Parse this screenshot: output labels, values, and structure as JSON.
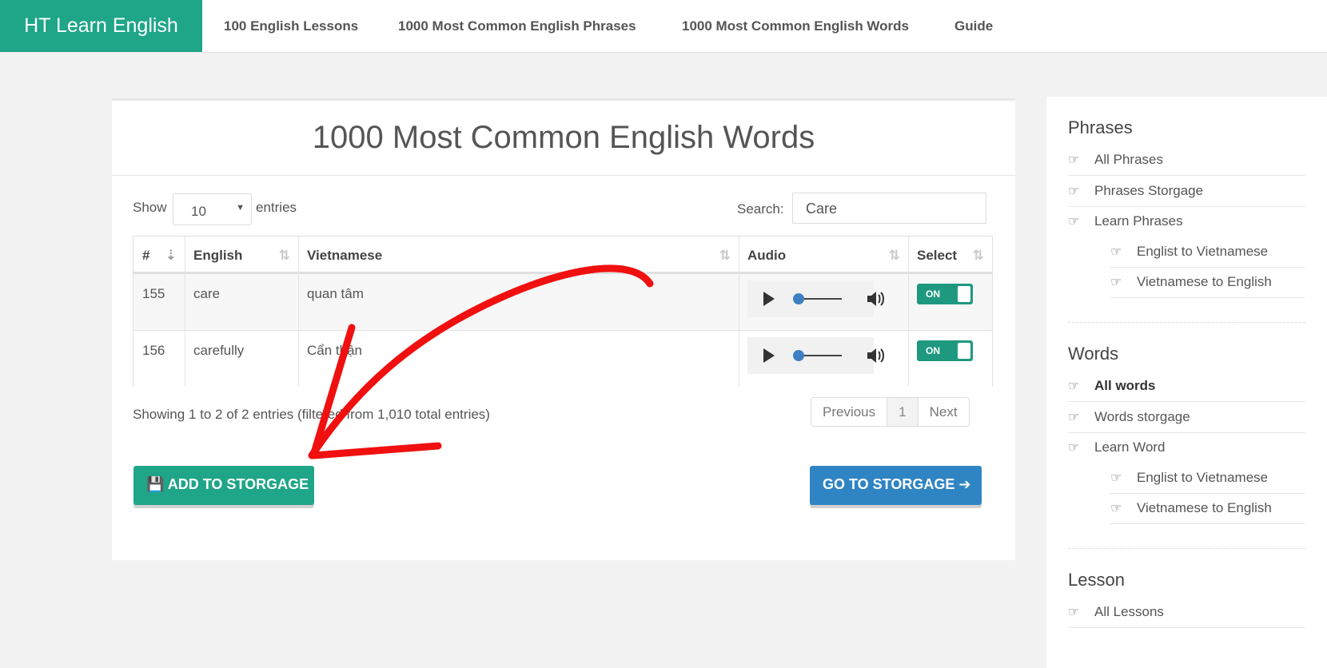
{
  "nav": {
    "brand": "HT Learn English",
    "links": [
      "100 English Lessons",
      "1000 Most Common English Phrases",
      "1000 Most Common English Words",
      "Guide"
    ]
  },
  "main": {
    "title": "1000 Most Common English Words",
    "show_label": "Show",
    "entries_value": "10",
    "entries_label": "entries",
    "search_label": "Search:",
    "search_value": "Care",
    "columns": [
      "#",
      "English",
      "Vietnamese",
      "Audio",
      "Select"
    ],
    "rows": [
      {
        "num": "155",
        "english": "care",
        "vietnamese": "quan tâm",
        "toggle": "ON"
      },
      {
        "num": "156",
        "english": "carefully",
        "vietnamese": "Cẩn thận",
        "toggle": "ON"
      }
    ],
    "info": "Showing 1 to 2 of 2 entries (filtered from 1,010 total entries)",
    "pagination": {
      "previous": "Previous",
      "page": "1",
      "next": "Next"
    },
    "add_button": "ADD TO STORGAGE",
    "go_button": "GO TO STORGAGE"
  },
  "sidebar": {
    "phrases_heading": "Phrases",
    "phrases_items": [
      "All Phrases",
      "Phrases Storgage",
      "Learn Phrases"
    ],
    "phrases_sub": [
      "Englist to Vietnamese",
      "Vietnamese to English"
    ],
    "words_heading": "Words",
    "words_items": [
      "All words",
      "Words storgage",
      "Learn Word"
    ],
    "words_sub": [
      "Englist to Vietnamese",
      "Vietnamese to English"
    ],
    "lesson_heading": "Lesson",
    "lesson_items": [
      "All Lessons"
    ]
  },
  "colors": {
    "brand": "#1fa588",
    "primary": "#2f84c3",
    "annotation": "#f01010"
  }
}
